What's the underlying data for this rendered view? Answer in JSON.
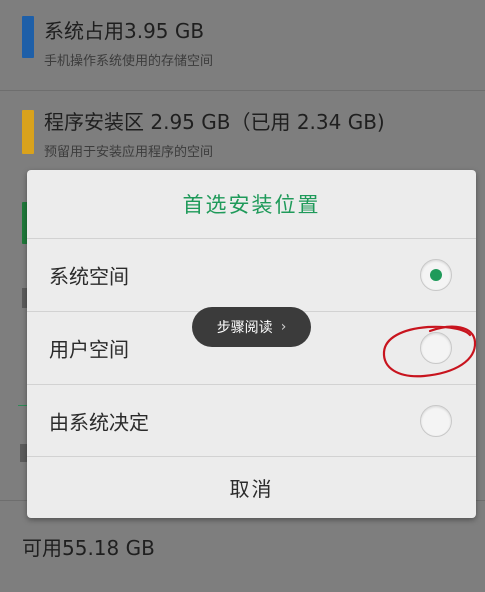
{
  "background": {
    "system": {
      "title": "系统占用3.95  GB",
      "subtitle": "手机操作系统使用的存储空间",
      "bar_color": "#1e5fa8"
    },
    "app_area": {
      "title": "程序安装区  2.95  GB（已用  2.34  GB)",
      "subtitle": "预留用于安装应用程序的空间",
      "bar_color": "#d9a21c"
    },
    "third_bar_color": "#1f7a3a",
    "free": "可用55.18  GB"
  },
  "dialog": {
    "title": "首选安装位置",
    "accent": "#1f9a5a",
    "options": [
      {
        "label": "系统空间",
        "selected": true
      },
      {
        "label": "用户空间",
        "selected": false
      },
      {
        "label": "由系统决定",
        "selected": false
      }
    ],
    "cancel_label": "取消"
  },
  "toast": {
    "label": "步骤阅读",
    "chevron": "›"
  },
  "annotation": {
    "color": "#c8141e",
    "shape": "hand-drawn circle around second radio"
  }
}
